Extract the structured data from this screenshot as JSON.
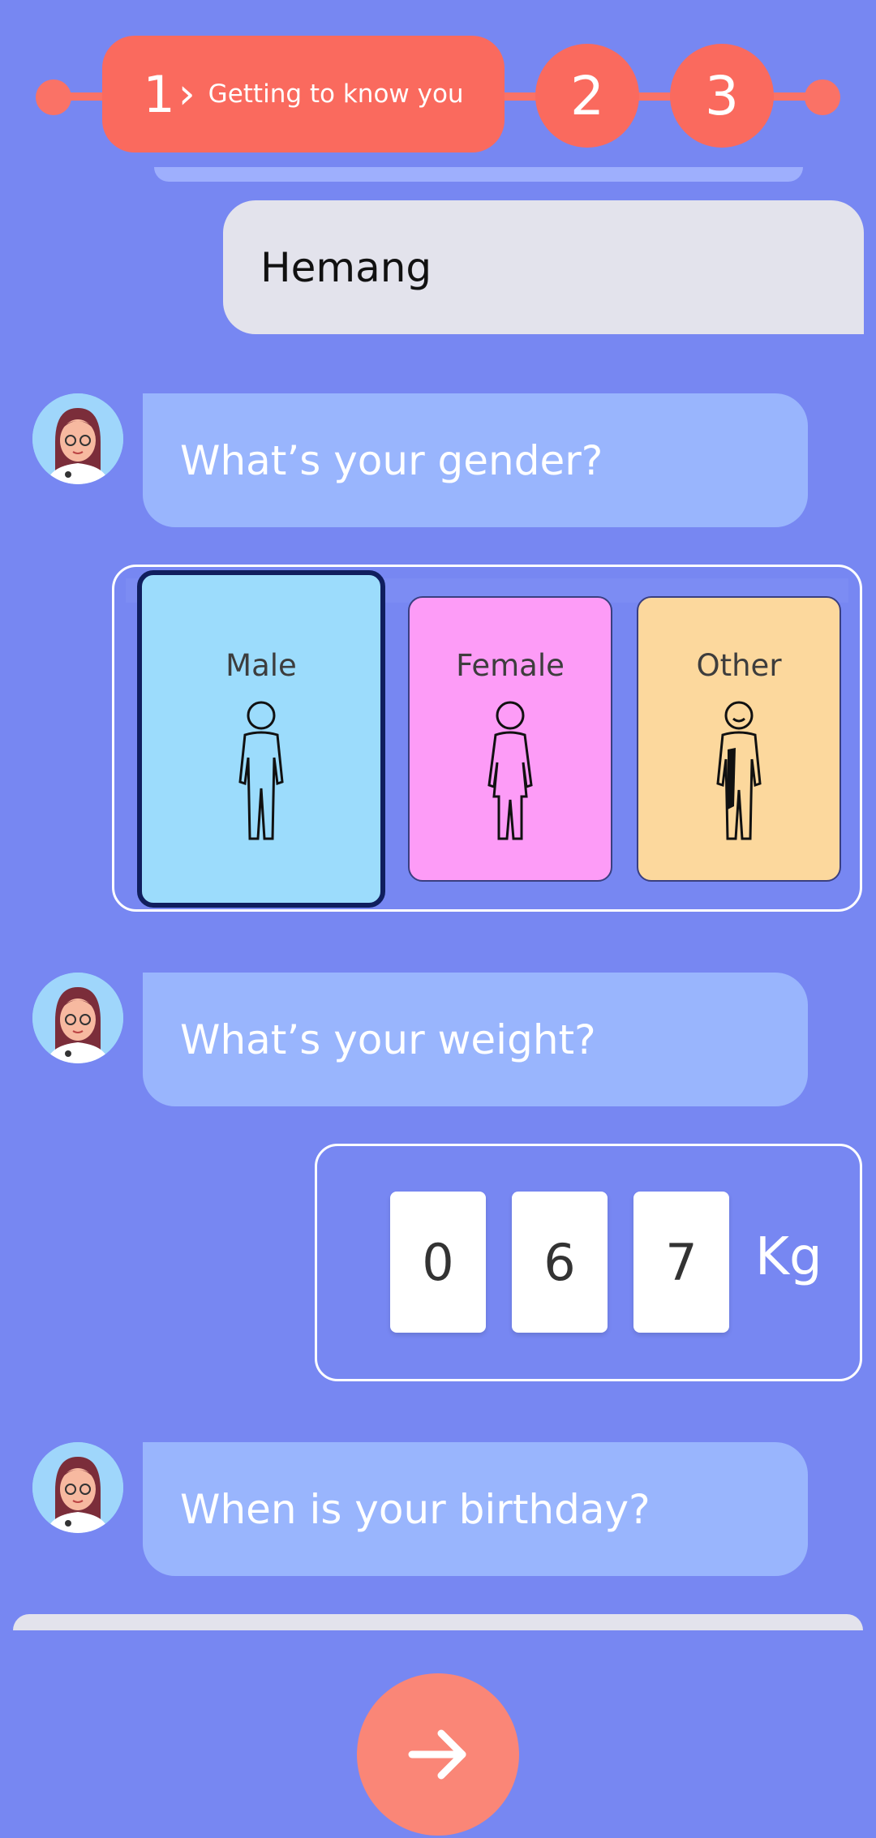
{
  "stepper": {
    "current_step": "1",
    "current_label": "Getting to know you",
    "step2": "2",
    "step3": "3"
  },
  "chat": {
    "user_name_reply": "Hemang",
    "q_gender": "What’s your gender?",
    "q_weight": "What’s your weight?",
    "q_birthday": "When is your birthday?"
  },
  "gender": {
    "selected": "Male",
    "options": [
      "Male",
      "Female",
      "Other"
    ]
  },
  "weight": {
    "digits": [
      "0",
      "6",
      "7"
    ],
    "unit": "Kg"
  },
  "colors": {
    "background": "#7787f2",
    "accent": "#fa6a5e",
    "question_bubble": "#99b5fd",
    "male": "#9cdcfc",
    "female": "#fd9cf7",
    "other": "#fcd89d"
  },
  "icons": {
    "next": "arrow-right-icon",
    "step_chevron": "chevron-right-icon",
    "avatar": "doctor-avatar-icon"
  }
}
